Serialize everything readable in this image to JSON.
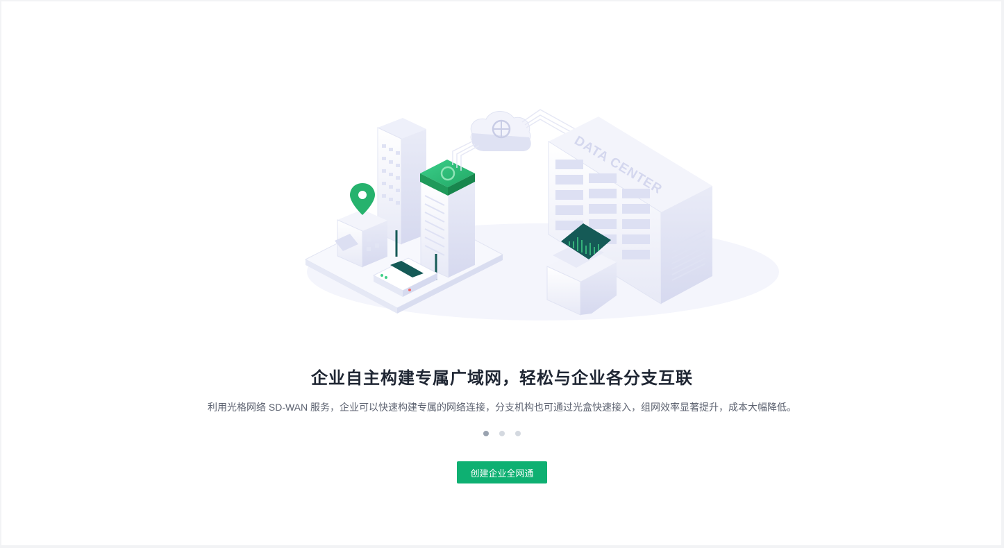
{
  "hero": {
    "illustration_text": "DATA CENTER",
    "title": "企业自主构建专属广域网，轻松与企业各分支互联",
    "description": "利用光格网络 SD-WAN 服务，企业可以快速构建专属的网络连接，分支机构也可通过光盒快速接入，组网效率显著提升，成本大幅降低。",
    "carousel": {
      "count": 3,
      "active_index": 0
    },
    "cta_label": "创建企业全网通"
  },
  "colors": {
    "brand_green": "#0eb072",
    "title_text": "#1f2633",
    "body_text": "#5c6270",
    "dot_active": "#9aa3b0",
    "dot_inactive": "#d4d9e0"
  },
  "icons": [
    "location-pin-icon",
    "cloud-globe-icon",
    "router-icon",
    "monitor-chart-icon"
  ]
}
